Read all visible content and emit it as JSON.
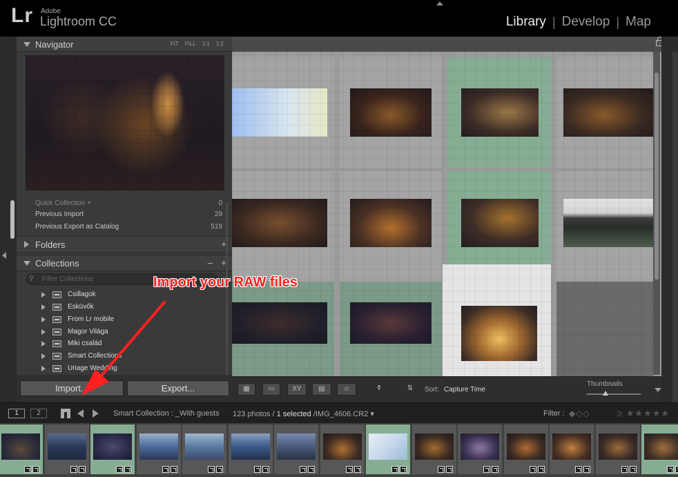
{
  "app": {
    "logo": "Lr",
    "vendor": "Adobe",
    "product": "Lightroom CC",
    "modules": [
      {
        "label": "Library",
        "active": true
      },
      {
        "label": "Develop",
        "active": false
      },
      {
        "label": "Map",
        "active": false
      }
    ]
  },
  "navigator": {
    "title": "Navigator",
    "zoom": [
      "FIT",
      "FILL",
      "1:1",
      "1:2"
    ]
  },
  "catalog": {
    "items": [
      {
        "label": "Quick Collection +",
        "count": "0"
      },
      {
        "label": "Previous Import",
        "count": "29"
      },
      {
        "label": "Previous Export as Catalog",
        "count": "519"
      }
    ]
  },
  "folders": {
    "title": "Folders",
    "add": "+"
  },
  "collections": {
    "title": "Collections",
    "remove": "–",
    "add": "+",
    "filter_placeholder": "Filter Collections",
    "items": [
      "Csillagok",
      "Esküvők",
      "From Lr mobile",
      "Magor Világa",
      "Miki család",
      "Smart Collections",
      "Uriage Wedding"
    ]
  },
  "buttons": {
    "import": "Import...",
    "export": "Export..."
  },
  "toolbar": {
    "sort_label": "Sort:",
    "sort_value": "Capture Time",
    "thumbnails_label": "Thumbnails",
    "thumbnail_size": 0.35
  },
  "filmstrip": {
    "pages": [
      "1",
      "2"
    ],
    "source": "Smart Collection : _With guests",
    "count_text": "123 photos / ",
    "selected_text": "1 selected",
    "file_text": " /IMG_4606.CR2",
    "filter_label": "Filter :",
    "flags": "◆◇◇",
    "stars": "≥ ★★★★★"
  },
  "annotation": {
    "text": "Import your RAW files"
  },
  "colors": {
    "selected": "#86ad94",
    "annotation": "#ff2020"
  }
}
